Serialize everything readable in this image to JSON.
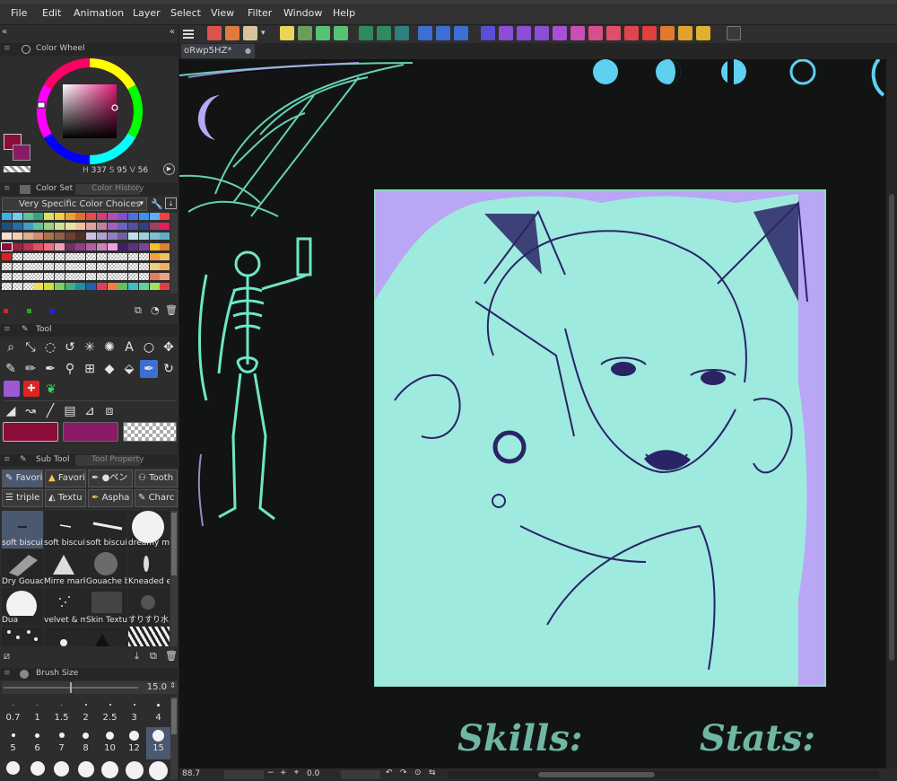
{
  "menu": [
    "File",
    "Edit",
    "Animation",
    "Layer",
    "Select",
    "View",
    "Filter",
    "Window",
    "Help"
  ],
  "document_tab": "oRwp5HZ*",
  "color_wheel": {
    "title": "Color Wheel",
    "h": "337",
    "s": "95",
    "v": "56",
    "main_color": "#8a0d3c",
    "sub_color": "#8a1a66"
  },
  "color_set": {
    "tab_active": "Color Set",
    "tab_inactive": "Color History",
    "selected_set": "Very Specific Color Choices"
  },
  "tool": {
    "title": "Tool"
  },
  "sub_tool": {
    "tab_active": "Sub Tool",
    "tab_inactive": "Tool Property",
    "groups": [
      "Favori",
      "Favori",
      "●ペン",
      "Tooth",
      "triple li",
      "Textu",
      "Aspha",
      "Charc"
    ],
    "brushes": [
      "soft biscuit",
      "soft biscuit",
      "soft biscuit",
      "dreamy ma",
      "Dry Gouac",
      "Mirre mark",
      "Gouache b",
      "Kneaded e",
      "Dua",
      "velvet & m",
      "Skin Textu",
      "すりすり水"
    ]
  },
  "brush_size": {
    "title": "Brush Size",
    "value": "15.0",
    "presets": [
      "0.7",
      "1",
      "1.5",
      "2",
      "2.5",
      "3",
      "4",
      "5",
      "6",
      "7",
      "8",
      "10",
      "12",
      "15"
    ],
    "selected": "15"
  },
  "status": {
    "zoom": "88.7",
    "rotation": "0.0"
  },
  "canvas_text": {
    "skills": "Skills:",
    "stats": "Stats:"
  },
  "colors": {
    "accent": "#3c6fd1",
    "canvas_bg": "#121414",
    "mint": "#9eeadf",
    "lavender": "#b9a6f5",
    "ink": "#2a2466",
    "chalk": "#6ee6c6",
    "moon_blue": "#5fd0f0"
  }
}
